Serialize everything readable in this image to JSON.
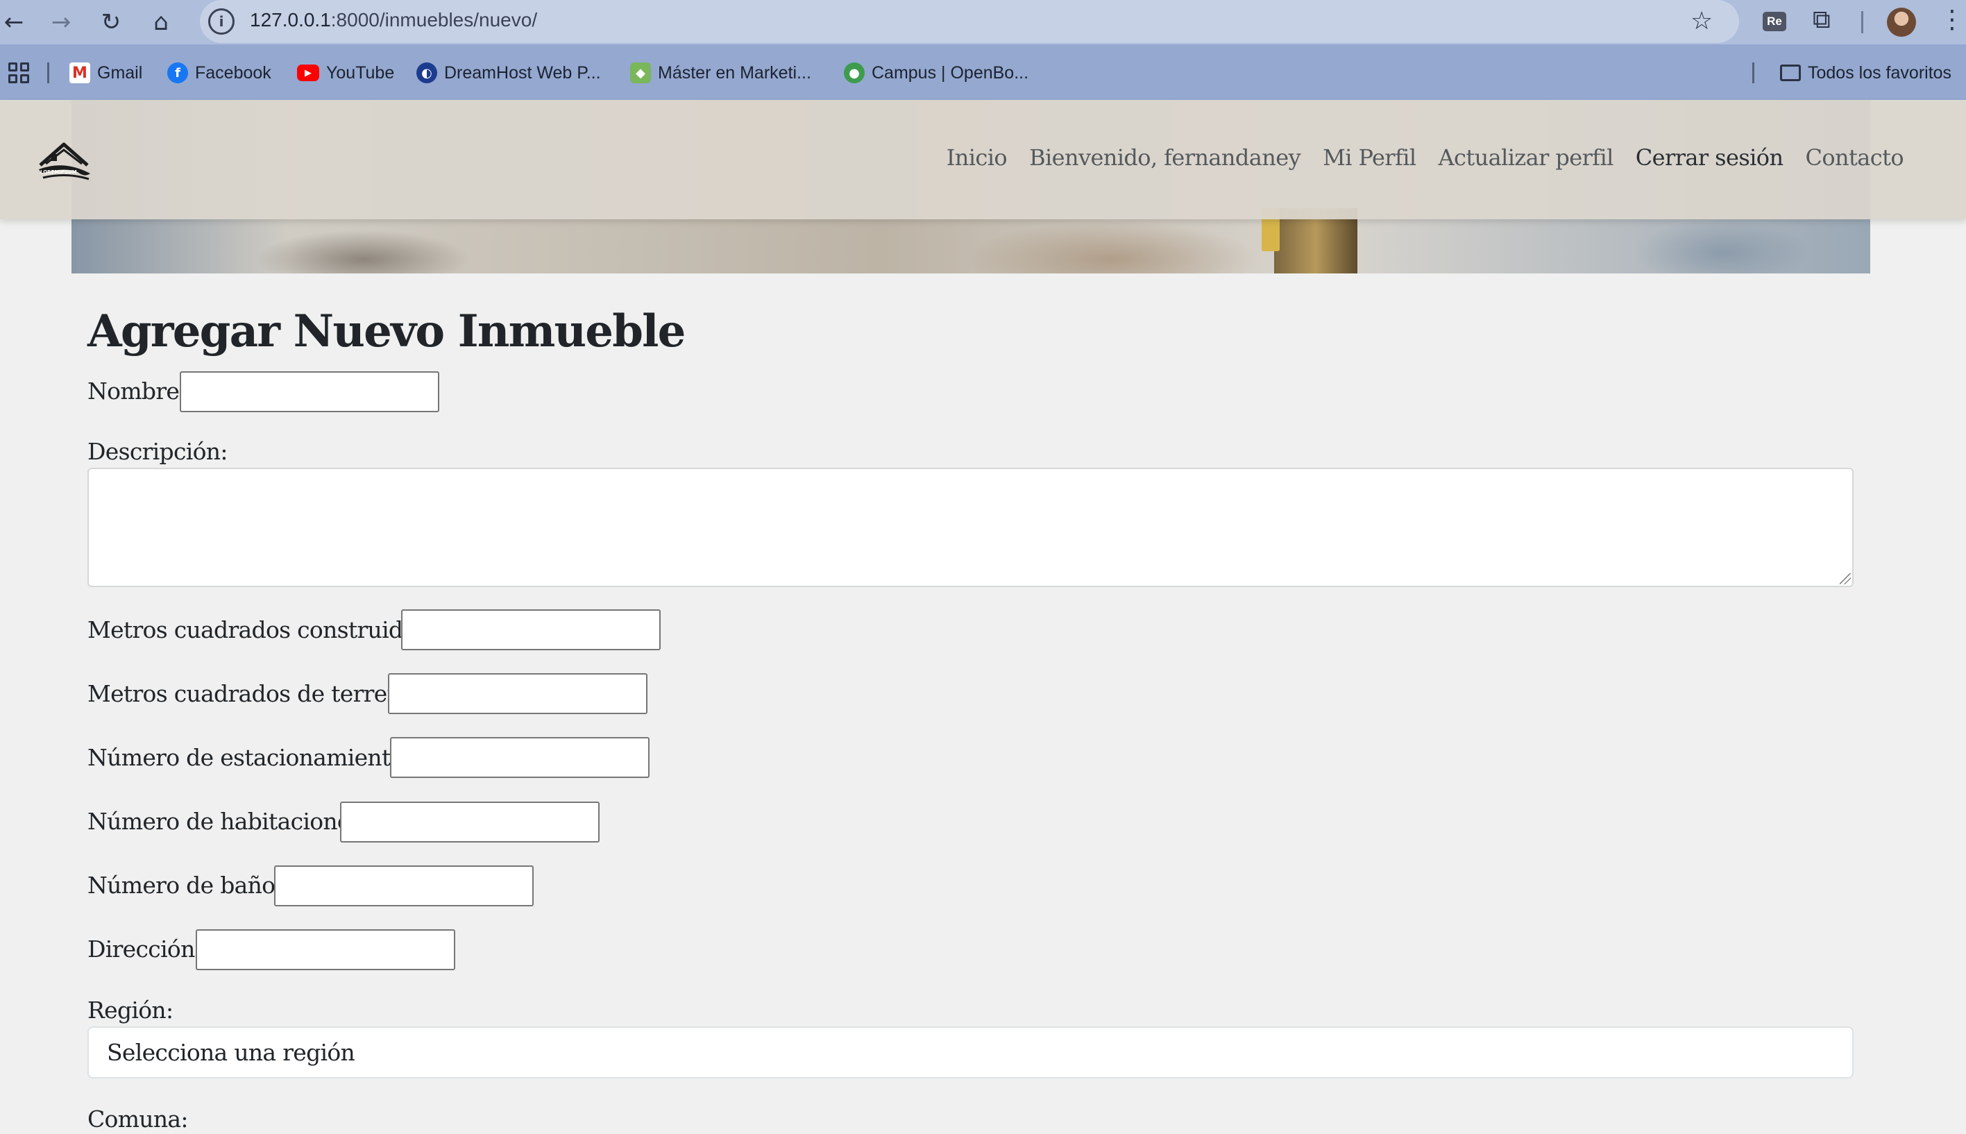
{
  "browser": {
    "url_host": "127.0.0.1",
    "url_rest": ":8000/inmuebles/nuevo/",
    "icons": [
      "back-icon",
      "forward-icon",
      "reload-icon",
      "home-icon",
      "site-info-icon",
      "bookmark-star-icon",
      "extension-re-icon",
      "extensions-puzzle-icon",
      "profile-avatar",
      "menu-dots-icon"
    ],
    "extension_label": "Re",
    "bookmarks": [
      {
        "label": "Gmail",
        "icon": "gmail-icon"
      },
      {
        "label": "Facebook",
        "icon": "facebook-icon"
      },
      {
        "label": "YouTube",
        "icon": "youtube-icon"
      },
      {
        "label": "DreamHost Web P...",
        "icon": "dreamhost-icon"
      },
      {
        "label": "Máster en Marketi...",
        "icon": "marketing-icon"
      },
      {
        "label": "Campus | OpenBo...",
        "icon": "openbootcamp-icon"
      }
    ],
    "all_bookmarks_label": "Todos los favoritos"
  },
  "site": {
    "logo_text": "LOREMIPSUM",
    "nav": {
      "inicio": "Inicio",
      "bienvenido": "Bienvenido, fernandaney",
      "perfil": "Mi Perfil",
      "actualizar": "Actualizar perfil",
      "cerrar": "Cerrar sesión",
      "contacto": "Contacto"
    }
  },
  "form": {
    "title": "Agregar Nuevo Inmueble",
    "nombre_label": "Nombre:",
    "descripcion_label": "Descripción:",
    "m2_construidos_label": "Metros cuadrados construidos:",
    "m2_terreno_label": "Metros cuadrados de terreno:",
    "estacionamientos_label": "Número de estacionamientos:",
    "habitaciones_label": "Número de habitaciones:",
    "banos_label": "Número de baños:",
    "direccion_label": "Dirección:",
    "region_label": "Región:",
    "region_selected": "Selecciona una región",
    "comuna_label": "Comuna:"
  }
}
